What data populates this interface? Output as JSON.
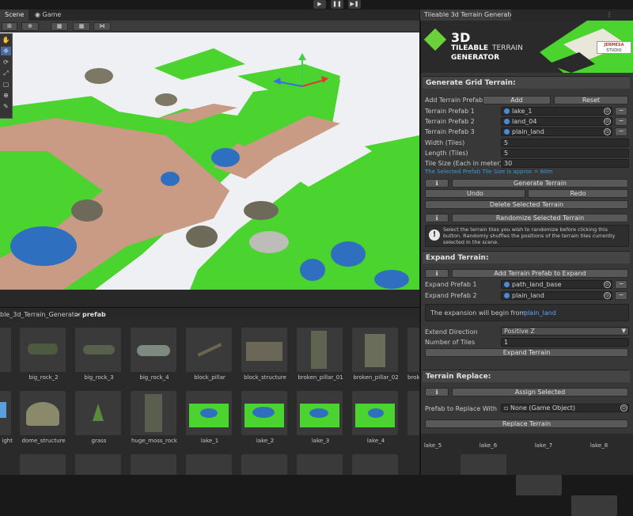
{
  "toolbar": {
    "play": "▶",
    "pause": "❚❚",
    "step": "▶❚"
  },
  "tabs": {
    "scene": "Scene",
    "game": "Game"
  },
  "scene_tools": {
    "t1": "⊞",
    "t2": "⊕",
    "t3": "▦",
    "t4": "▦",
    "t5": "⋈"
  },
  "left_tools": [
    "✋",
    "✥",
    "⟳",
    "⤢",
    "▢",
    "⊕",
    "✎"
  ],
  "breadcrumb": {
    "path": "ble_3d_Terrain_Generator",
    "sep": ">",
    "folder": "prefab"
  },
  "assets_row1": [
    "",
    "big_rock_2",
    "big_rock_3",
    "big_rock_4",
    "block_pillar",
    "block_structure",
    "broken_pillar_01",
    "broken_pillar_02",
    "brok"
  ],
  "assets_row2": [
    "ight",
    "dome_structure",
    "grass",
    "huge_moss_rock",
    "lake_1",
    "lake_2",
    "lake_3",
    "lake_4",
    "lake_5",
    "lake_6",
    "lake_7",
    "lake_8"
  ],
  "window": {
    "title": "Tileable 3d Terrain Generator",
    "logo_3d": "3D",
    "logo_line1": "TILEABLE",
    "logo_line2": "TERRAIN",
    "logo_line3": "GENERATOR",
    "studio_line1": "JERMESA",
    "studio_line2": "STUDIO",
    "grid": {
      "header": "Generate Grid Terrain:",
      "add_prefab_label": "Add Terrain Prefab:",
      "add_btn": "Add",
      "reset_btn": "Reset",
      "prefabs": [
        {
          "label": "Terrain Prefab 1",
          "value": "lake_1"
        },
        {
          "label": "Terrain Prefab 2",
          "value": "land_04"
        },
        {
          "label": "Terrain Prefab 3",
          "value": "plain_land"
        }
      ],
      "width_label": "Width (Tiles)",
      "width_value": "5",
      "length_label": "Length (Tiles)",
      "length_value": "5",
      "tilesize_label": "Tile Size (Each in meter)",
      "tilesize_value": "30",
      "tilesize_info": "The Selected Prefab Tile Size is approx = 60m",
      "info_btn": "ℹ",
      "generate_btn": "Generate Terrain",
      "undo_btn": "Undo",
      "redo_btn": "Redo",
      "delete_btn": "Delete Selected Terrain",
      "randomize_btn": "Randomize Selected Terrain",
      "help_text": "Select the terrain tiles you wish to randomize before clicking this button. Randomly shuffles the positions of the terrain tiles currently selected in the scene."
    },
    "expand": {
      "header": "Expand Terrain:",
      "add_btn": "Add Terrain Prefab to Expand",
      "prefabs": [
        {
          "label": "Expand Prefab 1",
          "value": "path_land_base"
        },
        {
          "label": "Expand Prefab 2",
          "value": "plain_land"
        }
      ],
      "begin_label": "The expansion will begin from:",
      "begin_value": "plain_land",
      "direction_label": "Extend Direction",
      "direction_value": "Positive Z",
      "tiles_label": "Number of Tiles",
      "tiles_value": "1",
      "expand_btn": "Expand Terrain"
    },
    "replace": {
      "header": "Terrain Replace:",
      "assign_btn": "Assign Selected",
      "prefab_label": "Prefab to Replace With",
      "prefab_value": "None (Game Object)",
      "replace_btn": "Replace Terrain"
    },
    "remove_icon": "−",
    "target_icon": "⊙"
  },
  "colors": {
    "grass": "#4bd32f",
    "path": "#c99a84",
    "water": "#2f6fc0",
    "accent_text": "#5aa8ff",
    "info_text": "#3a9ad9"
  }
}
